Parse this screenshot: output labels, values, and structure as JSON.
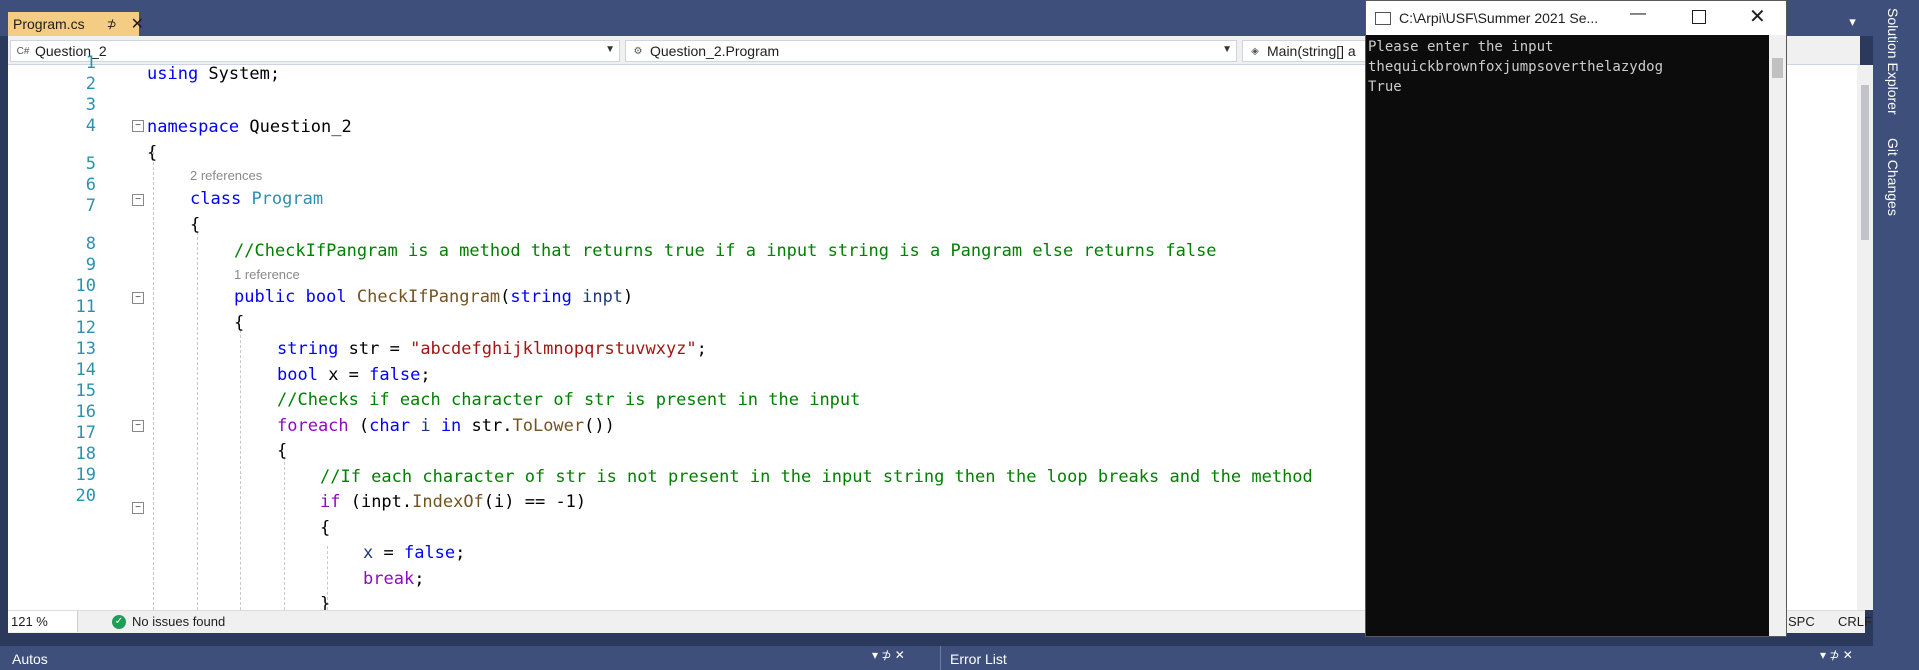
{
  "tabbar": {
    "file_tab": "Program.cs",
    "pin": "⊅",
    "close": "✕",
    "dropdown": "▾",
    "settings": "⚙"
  },
  "navbar": {
    "project": "Question_2",
    "type": "Question_2.Program",
    "member": "Main(string[] a"
  },
  "editor": {
    "line_numbers": [
      "1",
      "2",
      "3",
      "4",
      "5",
      "6",
      "7",
      "8",
      "9",
      "10",
      "11",
      "12",
      "13",
      "14",
      "15",
      "16",
      "17",
      "18",
      "19",
      "20"
    ],
    "lens_class": "2 references",
    "lens_method": "1 reference",
    "lines": {
      "l1": [
        "using",
        " System;"
      ],
      "l3": [
        "namespace",
        " Question_2"
      ],
      "l4": "{",
      "l5": [
        "class",
        "Program"
      ],
      "l6": "{",
      "l7": "//CheckIfPangram is a method that returns true if a input string is a Pangram else returns false",
      "l8": [
        "public",
        "bool",
        "CheckIfPangram",
        "(",
        "string",
        "inpt",
        ")"
      ],
      "l9": "{",
      "l10": [
        "string",
        " str = ",
        "\"abcdefghijklmnopqrstuvwxyz\"",
        ";"
      ],
      "l11": [
        "bool",
        " x = ",
        "false",
        ";"
      ],
      "l12": "//Checks if each character of str is present in the input",
      "l13": [
        "foreach",
        " (",
        "char",
        " i ",
        "in",
        " str.",
        "ToLower",
        "())"
      ],
      "l14": "{",
      "l15": "//If each character of str is not present in the input string then the loop breaks and the method",
      "l16": [
        "if",
        " (inpt.",
        "IndexOf",
        "(i) == -1)"
      ],
      "l17": "{",
      "l18": [
        "x",
        " = ",
        "false",
        ";"
      ],
      "l19": [
        "break",
        ";"
      ],
      "l20": "}"
    }
  },
  "status": {
    "zoom": "121 %",
    "issues": "No issues found",
    "spc": "SPC",
    "crlf": "CRLF"
  },
  "panels": {
    "left_title": "Autos",
    "right_title": "Error List",
    "controls": "▾ ⊅ ✕"
  },
  "side": {
    "solution_explorer": "Solution Explorer",
    "git_changes": "Git Changes"
  },
  "console": {
    "title": "C:\\Arpi\\USF\\Summer 2021 Se...",
    "output": "Please enter the input\nthequickbrownfoxjumpsoverthelazydog\nTrue"
  }
}
